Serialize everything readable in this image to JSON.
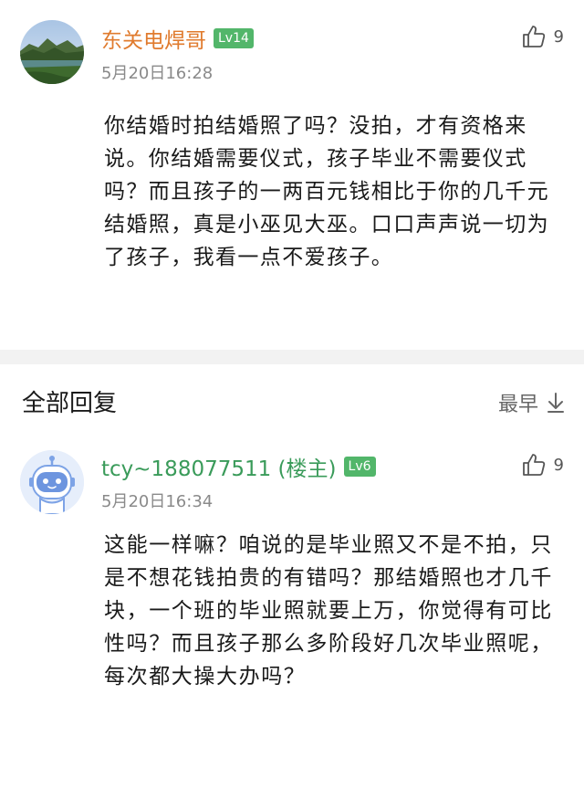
{
  "comment": {
    "author": "东关电焊哥",
    "level": "Lv14",
    "timestamp": "5月20日16:28",
    "likes": "9",
    "body": "你结婚时拍结婚照了吗？没拍，才有资格来说。你结婚需要仪式，孩子毕业不需要仪式吗？而且孩子的一两百元钱相比于你的几千元结婚照，真是小巫见大巫。口口声声说一切为了孩子，我看一点不爱孩子。"
  },
  "replies_section": {
    "title": "全部回复",
    "sort_label": "最早"
  },
  "reply": {
    "author": "tcy~188077511 (楼主)",
    "level": "Lv6",
    "timestamp": "5月20日16:34",
    "likes": "9",
    "body": "这能一样嘛？咱说的是毕业照又不是不拍，只是不想花钱拍贵的有错吗？那结婚照也才几千块，一个班的毕业照就要上万，你觉得有可比性吗？而且孩子那么多阶段好几次毕业照呢，每次都大操大办吗？"
  },
  "colors": {
    "author_orange": "#e07b2e",
    "author_green": "#3a9b5a",
    "level_badge": "#52b66a",
    "divider": "#f2f2f2"
  },
  "icons": {
    "like": "thumbs-up-icon",
    "sort": "arrow-down-icon"
  }
}
